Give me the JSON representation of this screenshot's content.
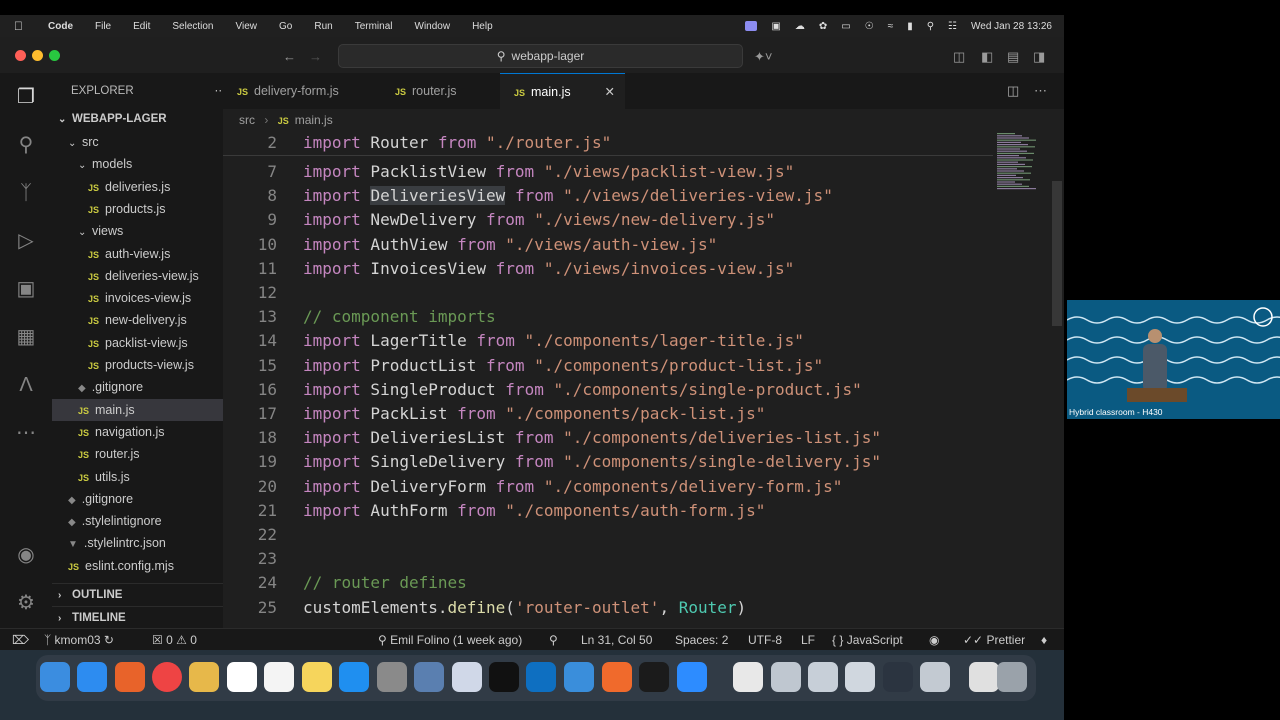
{
  "menubar": {
    "app": "Code",
    "items": [
      "File",
      "Edit",
      "Selection",
      "View",
      "Go",
      "Run",
      "Terminal",
      "Window",
      "Help"
    ],
    "datetime": "Wed Jan 28  13:26"
  },
  "window": {
    "search_label": "webapp-lager"
  },
  "sidebar": {
    "header": "EXPLORER",
    "project": "WEBAPP-LAGER",
    "tree": [
      {
        "label": "src",
        "type": "folder",
        "depth": 0
      },
      {
        "label": "models",
        "type": "folder",
        "depth": 1
      },
      {
        "label": "deliveries.js",
        "type": "js",
        "depth": 2
      },
      {
        "label": "products.js",
        "type": "js",
        "depth": 2
      },
      {
        "label": "views",
        "type": "folder",
        "depth": 1
      },
      {
        "label": "auth-view.js",
        "type": "js",
        "depth": 2
      },
      {
        "label": "deliveries-view.js",
        "type": "js",
        "depth": 2
      },
      {
        "label": "invoices-view.js",
        "type": "js",
        "depth": 2
      },
      {
        "label": "new-delivery.js",
        "type": "js",
        "depth": 2
      },
      {
        "label": "packlist-view.js",
        "type": "js",
        "depth": 2
      },
      {
        "label": "products-view.js",
        "type": "js",
        "depth": 2
      },
      {
        "label": ".gitignore",
        "type": "git",
        "depth": 1
      },
      {
        "label": "main.js",
        "type": "js",
        "depth": 1,
        "selected": true
      },
      {
        "label": "navigation.js",
        "type": "js",
        "depth": 1
      },
      {
        "label": "router.js",
        "type": "js",
        "depth": 1
      },
      {
        "label": "utils.js",
        "type": "js",
        "depth": 1
      },
      {
        "label": ".gitignore",
        "type": "git",
        "depth": 0
      },
      {
        "label": ".stylelintignore",
        "type": "git",
        "depth": 0
      },
      {
        "label": ".stylelintrc.json",
        "type": "json",
        "depth": 0
      },
      {
        "label": "eslint.config.mjs",
        "type": "js",
        "depth": 0
      }
    ],
    "outline": "OUTLINE",
    "timeline": "TIMELINE"
  },
  "tabs": [
    {
      "label": "delivery-form.js",
      "active": false
    },
    {
      "label": "router.js",
      "active": false
    },
    {
      "label": "main.js",
      "active": true
    }
  ],
  "breadcrumb": [
    "src",
    "main.js"
  ],
  "editor": {
    "sticky": {
      "n": "2",
      "tokens": [
        [
          "kw",
          "import"
        ],
        [
          "id",
          " Router "
        ],
        [
          "kw",
          "from"
        ],
        [
          "str",
          " \"./router.js\""
        ]
      ]
    },
    "lines": [
      {
        "n": "7",
        "tokens": [
          [
            "kw",
            "import"
          ],
          [
            "id",
            " PacklistView "
          ],
          [
            "kw",
            "from"
          ],
          [
            "str",
            " \"./views/packlist-view.js\""
          ]
        ]
      },
      {
        "n": "8",
        "tokens": [
          [
            "kw",
            "import"
          ],
          [
            "id",
            " "
          ],
          [
            "hl",
            "DeliveriesView"
          ],
          [
            "id",
            " "
          ],
          [
            "kw",
            "from"
          ],
          [
            "str",
            " \"./views/deliveries-view.js\""
          ]
        ]
      },
      {
        "n": "9",
        "tokens": [
          [
            "kw",
            "import"
          ],
          [
            "id",
            " NewDelivery "
          ],
          [
            "kw",
            "from"
          ],
          [
            "str",
            " \"./views/new-delivery.js\""
          ]
        ]
      },
      {
        "n": "10",
        "tokens": [
          [
            "kw",
            "import"
          ],
          [
            "id",
            " AuthView "
          ],
          [
            "kw",
            "from"
          ],
          [
            "str",
            " \"./views/auth-view.js\""
          ]
        ]
      },
      {
        "n": "11",
        "tokens": [
          [
            "kw",
            "import"
          ],
          [
            "id",
            " InvoicesView "
          ],
          [
            "kw",
            "from"
          ],
          [
            "str",
            " \"./views/invoices-view.js\""
          ]
        ]
      },
      {
        "n": "12",
        "tokens": []
      },
      {
        "n": "13",
        "tokens": [
          [
            "cm",
            "// component imports"
          ]
        ]
      },
      {
        "n": "14",
        "tokens": [
          [
            "kw",
            "import"
          ],
          [
            "id",
            " LagerTitle "
          ],
          [
            "kw",
            "from"
          ],
          [
            "str",
            " \"./components/lager-title.js\""
          ]
        ]
      },
      {
        "n": "15",
        "tokens": [
          [
            "kw",
            "import"
          ],
          [
            "id",
            " ProductList "
          ],
          [
            "kw",
            "from"
          ],
          [
            "str",
            " \"./components/product-list.js\""
          ]
        ]
      },
      {
        "n": "16",
        "tokens": [
          [
            "kw",
            "import"
          ],
          [
            "id",
            " SingleProduct "
          ],
          [
            "kw",
            "from"
          ],
          [
            "str",
            " \"./components/single-product.js\""
          ]
        ]
      },
      {
        "n": "17",
        "tokens": [
          [
            "kw",
            "import"
          ],
          [
            "id",
            " PackList "
          ],
          [
            "kw",
            "from"
          ],
          [
            "str",
            " \"./components/pack-list.js\""
          ]
        ]
      },
      {
        "n": "18",
        "tokens": [
          [
            "kw",
            "import"
          ],
          [
            "id",
            " DeliveriesList "
          ],
          [
            "kw",
            "from"
          ],
          [
            "str",
            " \"./components/deliveries-list.js\""
          ]
        ]
      },
      {
        "n": "19",
        "tokens": [
          [
            "kw",
            "import"
          ],
          [
            "id",
            " SingleDelivery "
          ],
          [
            "kw",
            "from"
          ],
          [
            "str",
            " \"./components/single-delivery.js\""
          ]
        ]
      },
      {
        "n": "20",
        "tokens": [
          [
            "kw",
            "import"
          ],
          [
            "id",
            " DeliveryForm "
          ],
          [
            "kw",
            "from"
          ],
          [
            "str",
            " \"./components/delivery-form.js\""
          ]
        ]
      },
      {
        "n": "21",
        "tokens": [
          [
            "kw",
            "import"
          ],
          [
            "id",
            " AuthForm "
          ],
          [
            "kw",
            "from"
          ],
          [
            "str",
            " \"./components/auth-form.js\""
          ]
        ]
      },
      {
        "n": "22",
        "tokens": []
      },
      {
        "n": "23",
        "tokens": []
      },
      {
        "n": "24",
        "tokens": [
          [
            "cm",
            "// router defines"
          ]
        ]
      },
      {
        "n": "25",
        "tokens": [
          [
            "id",
            "customElements."
          ],
          [
            "fn",
            "define"
          ],
          [
            "id",
            "("
          ],
          [
            "str",
            "'router-outlet'"
          ],
          [
            "id",
            ", "
          ],
          [
            "cls",
            "Router"
          ],
          [
            "id",
            ")"
          ]
        ]
      }
    ]
  },
  "statusbar": {
    "branch": "kmom03",
    "errors": "0",
    "warnings": "0",
    "blame": "Emil Folino (1 week ago)",
    "position": "Ln 31, Col 50",
    "spaces": "Spaces: 2",
    "encoding": "UTF-8",
    "eol": "LF",
    "language": "JavaScript",
    "formatter": "Prettier"
  },
  "video": {
    "label": "Hybrid classroom - H430"
  },
  "colors": {
    "accent": "#0078d4",
    "editor_bg": "#1f1f1f",
    "sidebar_bg": "#181818"
  }
}
